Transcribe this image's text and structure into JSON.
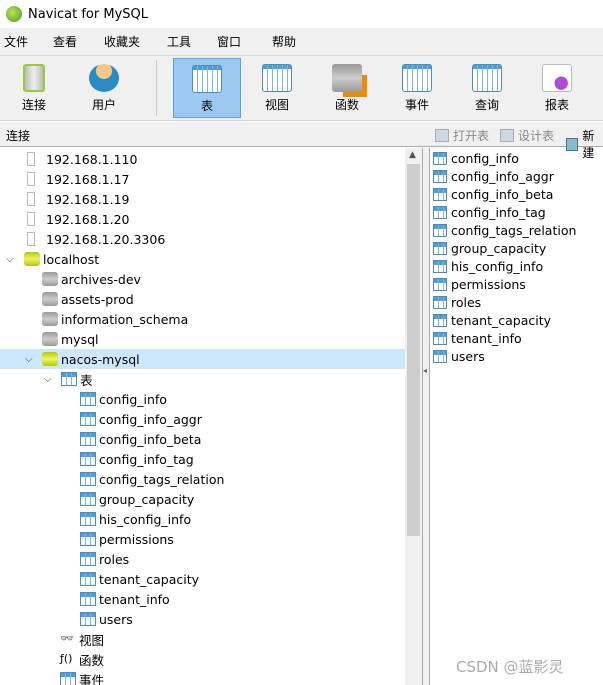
{
  "window": {
    "title": "Navicat for MySQL"
  },
  "menu": [
    "文件",
    "查看",
    "收藏夹",
    "工具",
    "窗口",
    "帮助"
  ],
  "toolbar": [
    {
      "label": "连接",
      "icon": "connection-icon"
    },
    {
      "label": "用户",
      "icon": "user-icon"
    },
    {
      "label": "表",
      "icon": "table-icon",
      "active": true
    },
    {
      "label": "视图",
      "icon": "view-icon"
    },
    {
      "label": "函数",
      "icon": "function-icon"
    },
    {
      "label": "事件",
      "icon": "event-icon"
    },
    {
      "label": "查询",
      "icon": "query-icon"
    },
    {
      "label": "报表",
      "icon": "report-icon"
    }
  ],
  "subbar": {
    "title": "连接",
    "actions": [
      "打开表",
      "设计表",
      "新建"
    ]
  },
  "tree": {
    "connections": [
      "192.168.1.110",
      "192.168.1.17",
      "192.168.1.19",
      "192.168.1.20",
      "192.168.1.20.3306"
    ],
    "localhost": "localhost",
    "databases": [
      "archives-dev",
      "assets-prod",
      "information_schema",
      "mysql",
      "nacos-mysql"
    ],
    "tables_group": "表",
    "tables": [
      "config_info",
      "config_info_aggr",
      "config_info_beta",
      "config_info_tag",
      "config_tags_relation",
      "group_capacity",
      "his_config_info",
      "permissions",
      "roles",
      "tenant_capacity",
      "tenant_info",
      "users"
    ],
    "views": "视图",
    "functions": "函数",
    "events": "事件"
  },
  "watermark": "CSDN @蓝影灵"
}
